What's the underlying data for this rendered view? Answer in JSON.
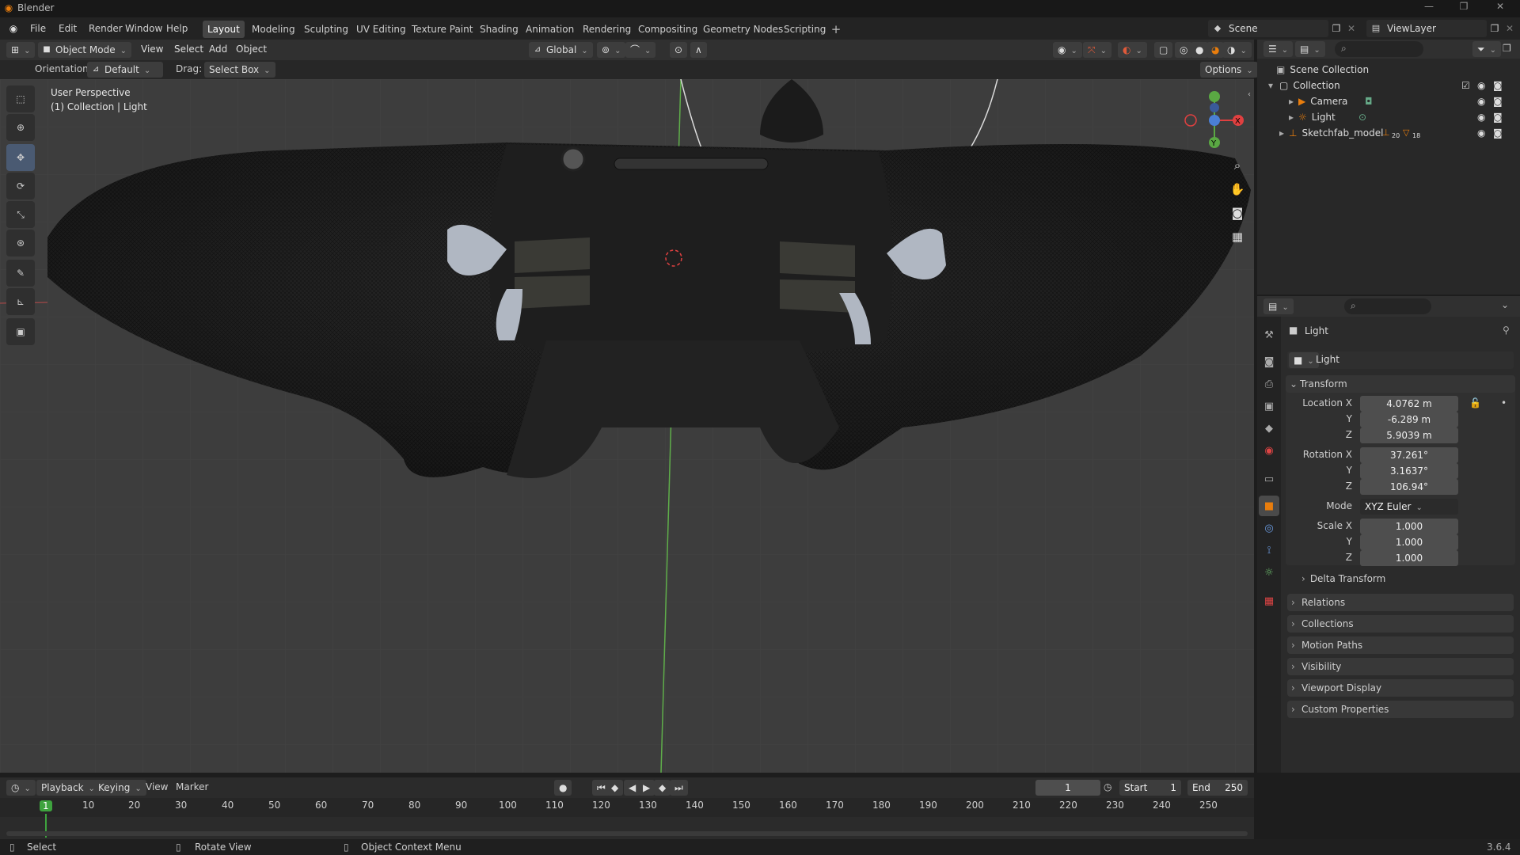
{
  "window": {
    "title": "Blender",
    "version": "3.6.4"
  },
  "menus": [
    "File",
    "Edit",
    "Render",
    "Window",
    "Help"
  ],
  "workspaces": [
    "Layout",
    "Modeling",
    "Sculpting",
    "UV Editing",
    "Texture Paint",
    "Shading",
    "Animation",
    "Rendering",
    "Compositing",
    "Geometry Nodes",
    "Scripting"
  ],
  "scene": {
    "name": "Scene",
    "view_layer": "ViewLayer"
  },
  "viewport_header": {
    "mode": "Object Mode",
    "menus": [
      "View",
      "Select",
      "Add",
      "Object"
    ],
    "transform_orientation": "Global",
    "orientation_label": "Orientation:",
    "orientation_value": "Default",
    "drag_label": "Drag:",
    "drag_value": "Select Box",
    "options": "Options"
  },
  "viewport": {
    "perspective": "User Perspective",
    "context": "(1) Collection | Light"
  },
  "outliner": {
    "items": [
      {
        "label": "Scene Collection",
        "icon": "scene-collection-icon"
      },
      {
        "label": "Collection",
        "icon": "collection-icon"
      },
      {
        "label": "Camera",
        "icon": "camera-icon"
      },
      {
        "label": "Light",
        "icon": "light-icon"
      },
      {
        "label": "Sketchfab_model",
        "icon": "empty-icon",
        "badge1": "20",
        "badge2": "18"
      }
    ]
  },
  "properties": {
    "object_name": "Light",
    "data_name": "Light",
    "transform_title": "Transform",
    "location": {
      "label": "Location X",
      "x": "4.0762 m",
      "y": "-6.289 m",
      "z": "5.9039 m"
    },
    "rotation": {
      "label": "Rotation X",
      "x": "37.261°",
      "y": "3.1637°",
      "z": "106.94°"
    },
    "mode_label": "Mode",
    "mode_value": "XYZ Euler",
    "scale": {
      "label": "Scale X",
      "x": "1.000",
      "y": "1.000",
      "z": "1.000"
    },
    "y_label": "Y",
    "z_label": "Z",
    "delta": "Delta Transform",
    "sections": [
      "Relations",
      "Collections",
      "Motion Paths",
      "Visibility",
      "Viewport Display",
      "Custom Properties"
    ]
  },
  "timeline": {
    "menus": [
      "Playback",
      "Keying",
      "View",
      "Marker"
    ],
    "current_frame": "1",
    "start_label": "Start",
    "start": "1",
    "end_label": "End",
    "end": "250",
    "ticks": [
      "1",
      "10",
      "20",
      "30",
      "40",
      "50",
      "60",
      "70",
      "80",
      "90",
      "100",
      "110",
      "120",
      "130",
      "140",
      "150",
      "160",
      "170",
      "180",
      "190",
      "200",
      "210",
      "220",
      "230",
      "240",
      "250"
    ]
  },
  "statusbar": {
    "select": "Select",
    "rotate": "Rotate View",
    "context": "Object Context Menu"
  },
  "colors": {
    "accent": "#4772b3",
    "active_tool": "#4a5a72",
    "x_axis": "#e04040",
    "y_axis": "#5aa843",
    "z_axis": "#4a7fd4",
    "frame": "#3ea33e"
  }
}
